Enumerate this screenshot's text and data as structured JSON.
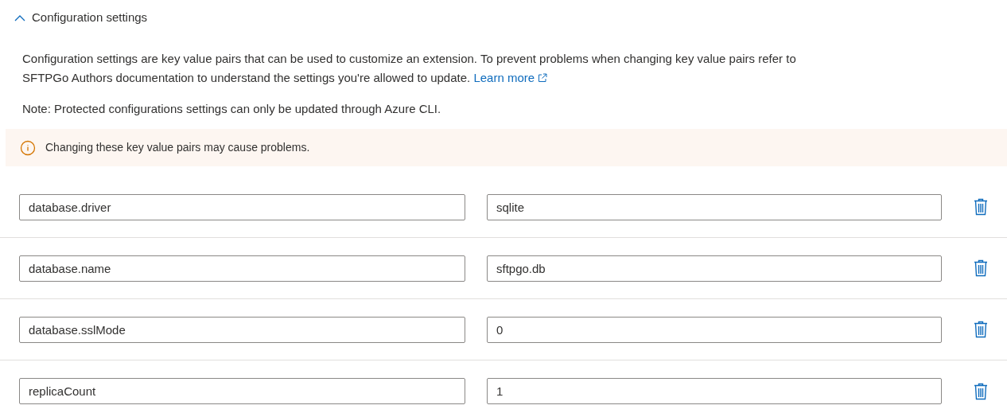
{
  "section": {
    "title": "Configuration settings",
    "expanded": true
  },
  "description": {
    "text": "Configuration settings are key value pairs that can be used to customize an extension. To prevent problems when changing key value pairs refer to SFTPGo Authors documentation to understand the settings you're allowed to update.",
    "link": "Learn more"
  },
  "note": "Note: Protected configurations settings can only be updated through Azure CLI.",
  "warning": "Changing these key value pairs may cause problems.",
  "settings": [
    {
      "key": "database.driver",
      "value": "sqlite"
    },
    {
      "key": "database.name",
      "value": "sftpgo.db"
    },
    {
      "key": "database.sslMode",
      "value": "0"
    },
    {
      "key": "replicaCount",
      "value": "1"
    }
  ]
}
